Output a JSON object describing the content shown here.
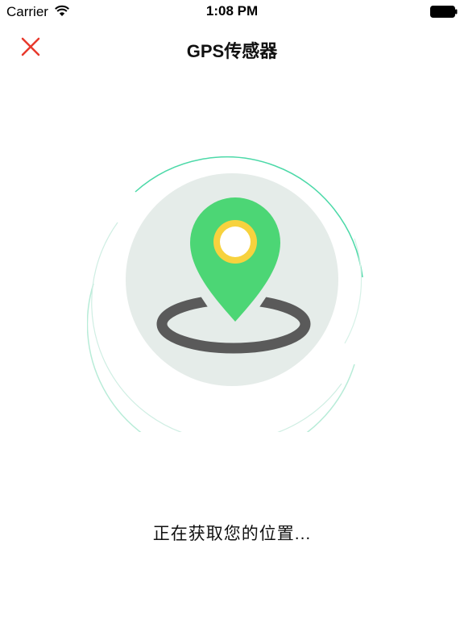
{
  "status_bar": {
    "carrier": "Carrier",
    "time": "1:08 PM",
    "wifi_icon": "wifi-icon",
    "battery_icon": "battery-icon"
  },
  "nav": {
    "title": "GPS传感器",
    "close_icon": "close-icon"
  },
  "illustration": {
    "icon": "location-pin-icon",
    "colors": {
      "pin": "#4cd675",
      "pin_ring": "#f7d23e",
      "circle_bg": "#e5ece9",
      "base_ring": "#5a5a5a",
      "orbit": "#4cd9a8",
      "close": "#e8392c"
    }
  },
  "message": "正在获取您的位置..."
}
